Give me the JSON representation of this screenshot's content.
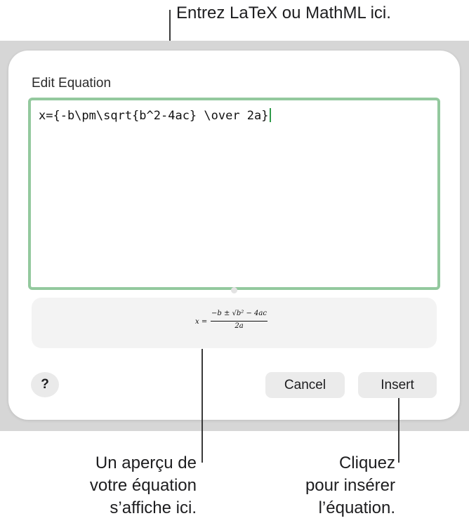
{
  "callouts": {
    "top": "Entrez LaTeX ou MathML ici.",
    "preview": [
      "Un aperçu de",
      "votre équation",
      "s’affiche ici."
    ],
    "insert": [
      "Cliquez",
      "pour insérer",
      "l’équation."
    ]
  },
  "dialog": {
    "title": "Edit Equation",
    "equation_value": "x={-b\\pm\\sqrt{b^2-4ac} \\over 2a}",
    "preview": {
      "lhs": "x =",
      "numerator": "−b ± √b² − 4ac",
      "denominator": "2a"
    },
    "help_label": "?",
    "cancel_label": "Cancel",
    "insert_label": "Insert"
  },
  "colors": {
    "editor_border": "#93c99e",
    "caret": "#2f9a4a",
    "backdrop": "#d6d6d6"
  }
}
